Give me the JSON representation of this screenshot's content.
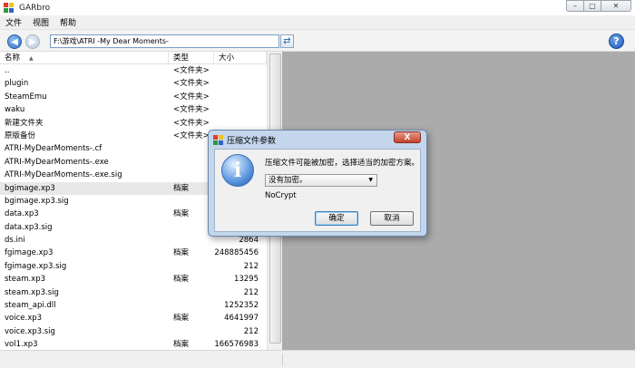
{
  "window": {
    "title": "GARbro"
  },
  "menu": {
    "items": [
      "文件",
      "视图",
      "帮助"
    ]
  },
  "toolbar": {
    "path": "F:\\游戏\\ATRI -My Dear Moments-"
  },
  "columns": {
    "name": "名称",
    "type": "类型",
    "size": "大小"
  },
  "files": [
    {
      "name": "..",
      "type": "<文件夹>",
      "size": ""
    },
    {
      "name": "plugin",
      "type": "<文件夹>",
      "size": ""
    },
    {
      "name": "SteamEmu",
      "type": "<文件夹>",
      "size": ""
    },
    {
      "name": "waku",
      "type": "<文件夹>",
      "size": ""
    },
    {
      "name": "新建文件夹",
      "type": "<文件夹>",
      "size": ""
    },
    {
      "name": "原版备份",
      "type": "<文件夹>",
      "size": ""
    },
    {
      "name": "ATRI-MyDearMoments-.cf",
      "type": "",
      "size": ""
    },
    {
      "name": "ATRI-MyDearMoments-.exe",
      "type": "",
      "size": ""
    },
    {
      "name": "ATRI-MyDearMoments-.exe.sig",
      "type": "",
      "size": ""
    },
    {
      "name": "bgimage.xp3",
      "type": "档案",
      "size": ""
    },
    {
      "name": "bgimage.xp3.sig",
      "type": "",
      "size": ""
    },
    {
      "name": "data.xp3",
      "type": "档案",
      "size": ""
    },
    {
      "name": "data.xp3.sig",
      "type": "",
      "size": ""
    },
    {
      "name": "ds.ini",
      "type": "",
      "size": "2864"
    },
    {
      "name": "fgimage.xp3",
      "type": "档案",
      "size": "248885456"
    },
    {
      "name": "fgimage.xp3.sig",
      "type": "",
      "size": "212"
    },
    {
      "name": "steam.xp3",
      "type": "档案",
      "size": "13295"
    },
    {
      "name": "steam.xp3.sig",
      "type": "",
      "size": "212"
    },
    {
      "name": "steam_api.dll",
      "type": "",
      "size": "1252352"
    },
    {
      "name": "voice.xp3",
      "type": "档案",
      "size": "4641997"
    },
    {
      "name": "voice.xp3.sig",
      "type": "",
      "size": "212"
    },
    {
      "name": "vol1.xp3",
      "type": "档案",
      "size": "166576983"
    }
  ],
  "selected_index": 9,
  "dialog": {
    "title": "压缩文件参数",
    "close_symbol": "X",
    "message": "压缩文件可能被加密，选择适当的加密方案。",
    "select_value": "没有加密。",
    "scheme_name": "NoCrypt",
    "ok_label": "确定",
    "cancel_label": "取消"
  }
}
